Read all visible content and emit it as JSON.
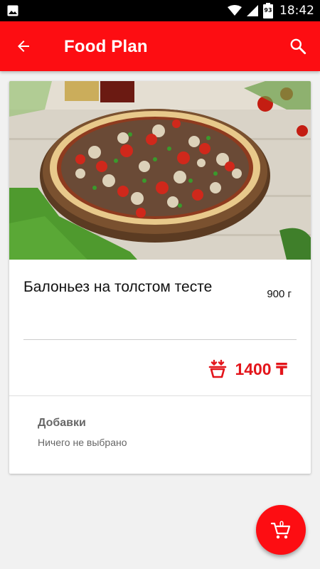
{
  "status_bar": {
    "time": "18:42",
    "battery_level": "93",
    "icons": [
      "gallery-icon",
      "wifi-icon",
      "signal-icon",
      "battery-icon"
    ]
  },
  "app_bar": {
    "title": "Food Plan",
    "back_icon": "arrow-back-icon",
    "search_icon": "search-icon",
    "color": "#fd0d12"
  },
  "product": {
    "name": "Балоньез на толстом тесте",
    "weight": "900 г",
    "price": "1400 ₸",
    "add_to_basket_icon": "basket-add-icon",
    "price_color": "#e3151b"
  },
  "addons": {
    "title": "Добавки",
    "value": "Ничего не выбрано"
  },
  "cart_fab": {
    "count": "0",
    "icon": "cart-icon"
  }
}
